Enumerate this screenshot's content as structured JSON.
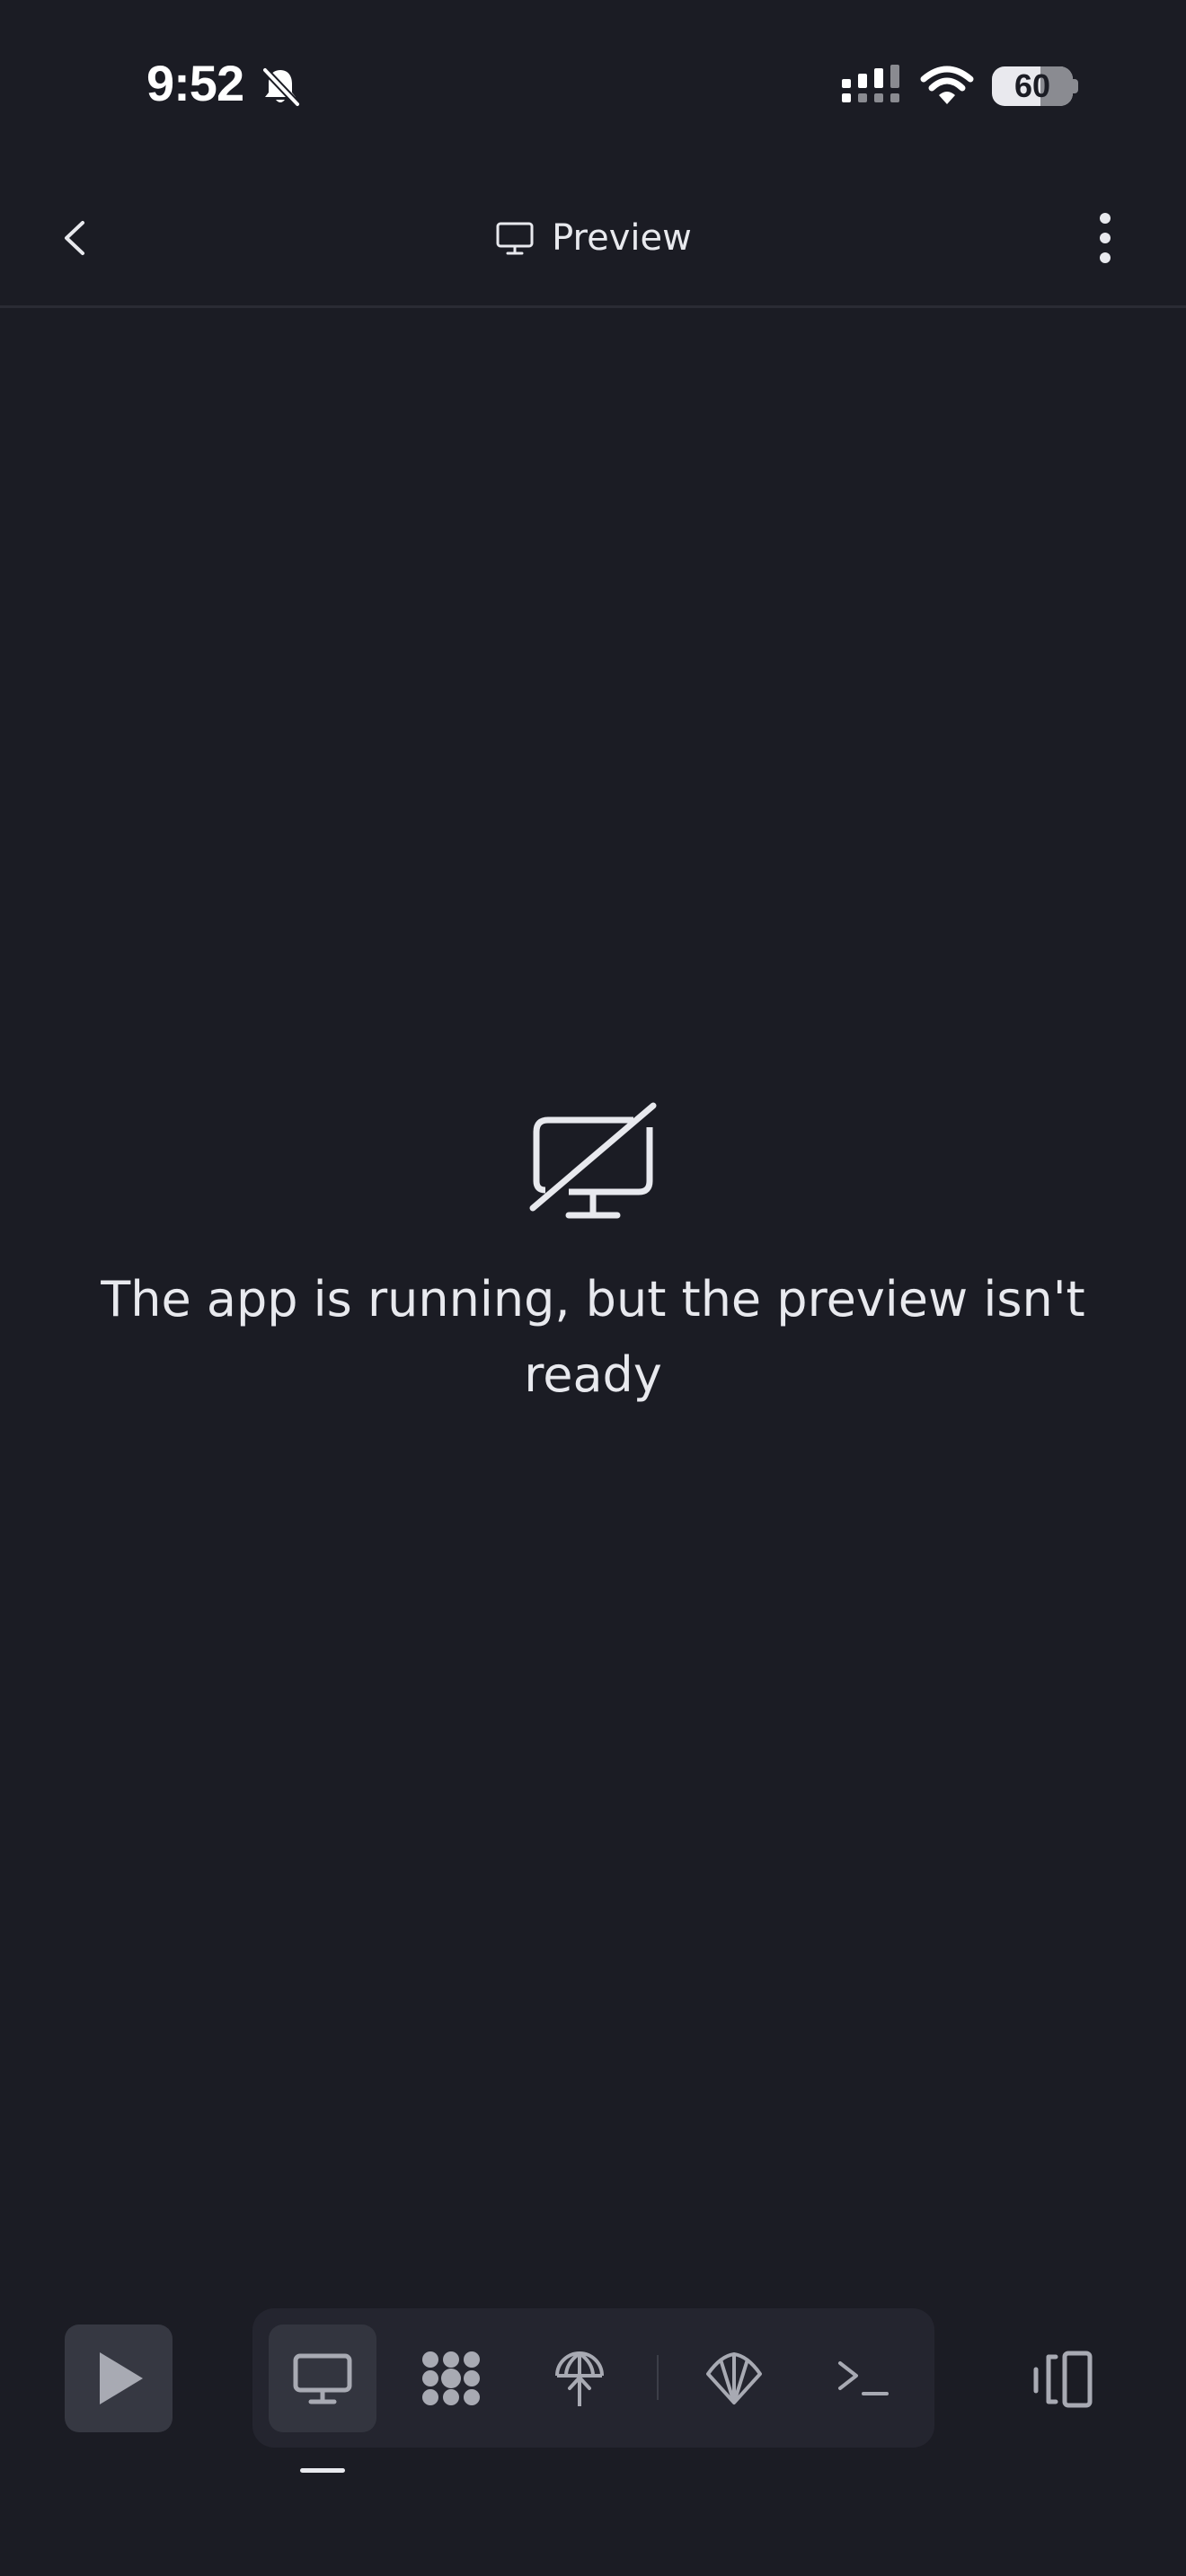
{
  "status_bar": {
    "time": "9:52",
    "battery": "60",
    "icons": [
      "bell-off-icon",
      "cellular-signal-icon",
      "wifi-icon",
      "battery-icon"
    ]
  },
  "header": {
    "back_icon": "chevron-left-icon",
    "title_icon": "monitor-icon",
    "title": "Preview",
    "more_icon": "more-vertical-icon"
  },
  "empty_state": {
    "icon": "monitor-off-icon",
    "message": "The app is running, but the preview isn't ready"
  },
  "toolbar": {
    "run_icon": "play-icon",
    "tabs": [
      {
        "icon": "monitor-icon",
        "active": true
      },
      {
        "icon": "agent-dots-icon",
        "active": false
      },
      {
        "icon": "deploy-globe-icon",
        "active": false
      },
      {
        "icon": "shell-icon",
        "active": false
      },
      {
        "icon": "terminal-icon",
        "active": false
      }
    ],
    "layout_icon": "split-layout-icon"
  },
  "colors": {
    "background": "#1b1c24",
    "surface": "#24252f",
    "active_surface": "#33353f",
    "text": "#e8e9ee",
    "icon_muted": "#a8aab3"
  }
}
